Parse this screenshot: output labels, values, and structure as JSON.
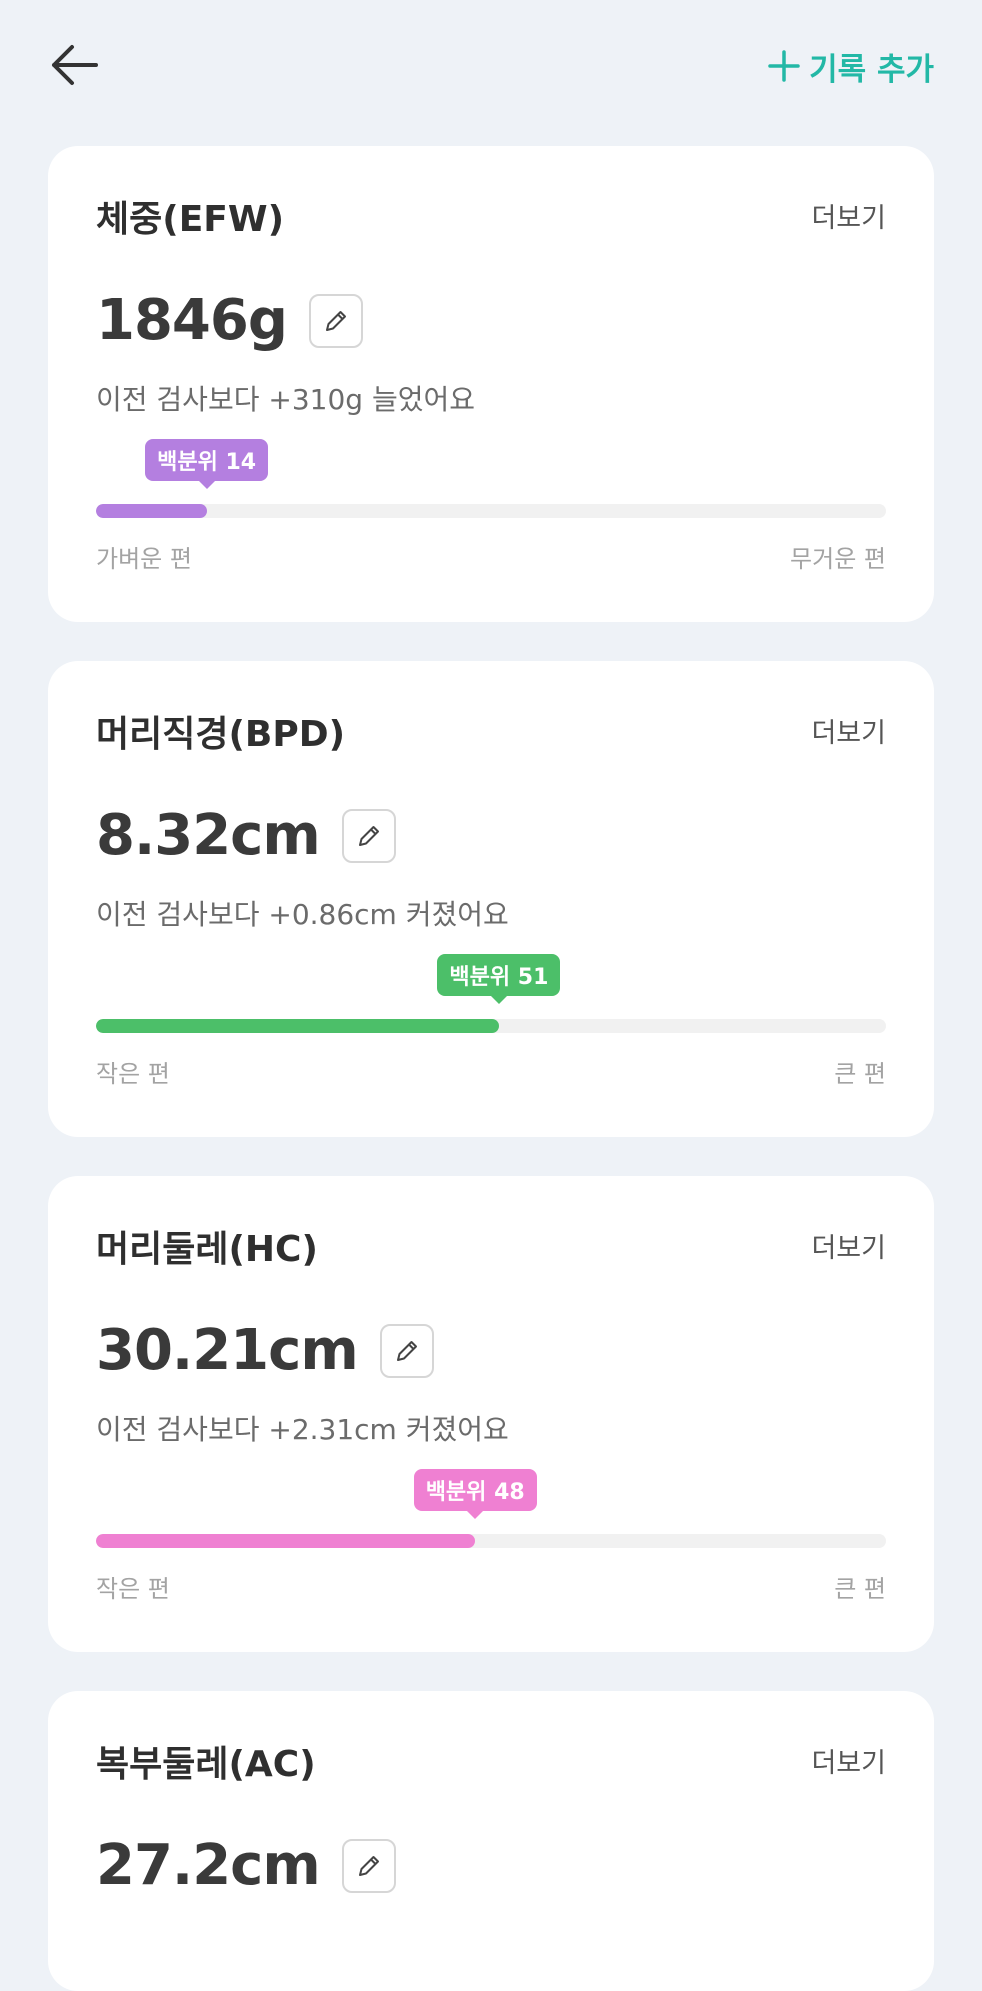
{
  "header": {
    "add_label": "기록 추가"
  },
  "cards": [
    {
      "title": "체중(EFW)",
      "more_label": "더보기",
      "value": "1846g",
      "compare_text": "이전 검사보다 +310g 늘었어요",
      "percentile_label": "백분위 14",
      "percentile": 14,
      "color": "#b47fe0",
      "left_label": "가벼운 편",
      "right_label": "무거운 편"
    },
    {
      "title": "머리직경(BPD)",
      "more_label": "더보기",
      "value": "8.32cm",
      "compare_text": "이전 검사보다 +0.86cm 커졌어요",
      "percentile_label": "백분위 51",
      "percentile": 51,
      "color": "#4cbf69",
      "left_label": "작은 편",
      "right_label": "큰 편"
    },
    {
      "title": "머리둘레(HC)",
      "more_label": "더보기",
      "value": "30.21cm",
      "compare_text": "이전 검사보다 +2.31cm 커졌어요",
      "percentile_label": "백분위 48",
      "percentile": 48,
      "color": "#ef80d2",
      "left_label": "작은 편",
      "right_label": "큰 편"
    },
    {
      "title": "복부둘레(AC)",
      "more_label": "더보기",
      "value": "27.2cm"
    }
  ]
}
